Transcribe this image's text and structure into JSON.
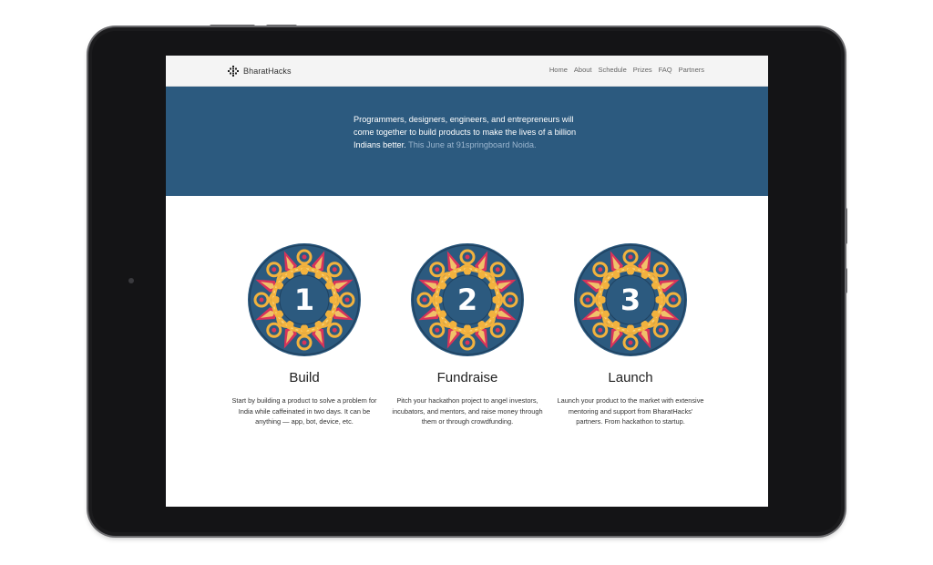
{
  "brand": {
    "name": "BharatHacks",
    "logo_icon": "grid-dots-icon"
  },
  "nav": {
    "items": [
      "Home",
      "About",
      "Schedule",
      "Prizes",
      "FAQ",
      "Partners"
    ]
  },
  "hero": {
    "text": "Programmers, designers, engineers, and entrepreneurs will come together to build products to make the lives of a billion Indians better.",
    "highlight": " This June at 91springboard Noida."
  },
  "steps": [
    {
      "number": "1",
      "title": "Build",
      "description": "Start by building a product to solve a problem for India while caffeinated in two days. It can be anything — app, bot, device, etc."
    },
    {
      "number": "2",
      "title": "Fundraise",
      "description": "Pitch your hackathon project to angel investors, incubators, and mentors, and raise money through them or through crowdfunding."
    },
    {
      "number": "3",
      "title": "Launch",
      "description": "Launch your product to the market with extensive mentoring and support from BharatHacks' partners. From hackathon to startup."
    }
  ],
  "colors": {
    "hero_bg": "#2c5a7f",
    "mandala_blue": "#2c5a7f",
    "mandala_gold": "#f2b23e",
    "mandala_pink": "#d9335a",
    "device": "#1b1b1d"
  }
}
